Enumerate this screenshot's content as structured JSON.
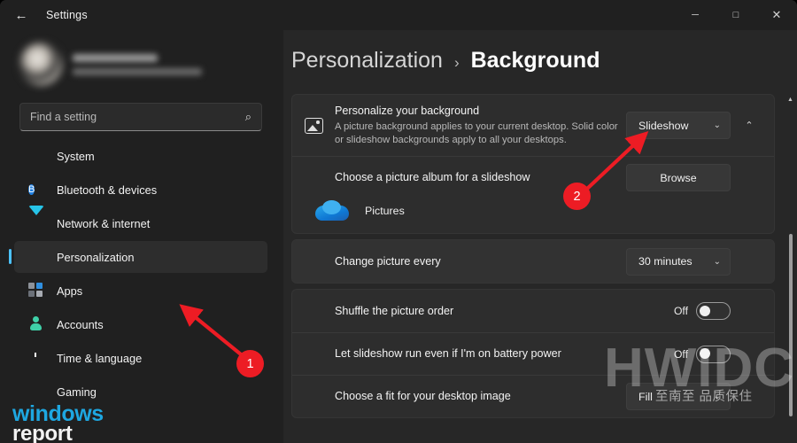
{
  "window": {
    "title": "Settings",
    "back_icon": "←",
    "minimize": "─",
    "maximize": "□",
    "close": "✕"
  },
  "sidebar": {
    "account": {
      "name_redacted": "",
      "email_redacted": ""
    },
    "search": {
      "placeholder": "Find a setting",
      "value": "",
      "icon": "⌕"
    },
    "items": [
      {
        "label": "System",
        "icon": "monitor-icon",
        "active": false
      },
      {
        "label": "Bluetooth & devices",
        "icon": "bluetooth-icon",
        "active": false
      },
      {
        "label": "Network & internet",
        "icon": "wifi-icon",
        "active": false
      },
      {
        "label": "Personalization",
        "icon": "brush-icon",
        "active": true
      },
      {
        "label": "Apps",
        "icon": "apps-icon",
        "active": false
      },
      {
        "label": "Accounts",
        "icon": "person-icon",
        "active": false
      },
      {
        "label": "Time & language",
        "icon": "clock-icon",
        "active": false
      },
      {
        "label": "Gaming",
        "icon": "gamepad-icon",
        "active": false
      }
    ]
  },
  "breadcrumb": {
    "parent": "Personalization",
    "separator": "›",
    "current": "Background"
  },
  "main": {
    "personalize": {
      "title": "Personalize your background",
      "description": "A picture background applies to your current desktop. Solid color or slideshow backgrounds apply to all your desktops.",
      "dropdown_value": "Slideshow",
      "dropdown_chevron": "⌄",
      "expander_chevron": "⌃"
    },
    "album": {
      "label": "Choose a picture album for a slideshow",
      "button": "Browse",
      "folder_name": "Pictures"
    },
    "change_every": {
      "label": "Change picture every",
      "value": "30 minutes",
      "chevron": "⌄"
    },
    "shuffle": {
      "label": "Shuffle the picture order",
      "state": "Off"
    },
    "battery": {
      "label": "Let slideshow run even if I'm on battery power",
      "state": "Off"
    },
    "fit": {
      "label": "Choose a fit for your desktop image",
      "value": "Fill",
      "chevron": "⌄"
    }
  },
  "scrollbar": {
    "up_arrow": "▲"
  },
  "annotations": [
    {
      "number": "1",
      "target": "sidebar-item-personalization"
    },
    {
      "number": "2",
      "target": "background-type-dropdown"
    }
  ],
  "watermarks": {
    "hwidc": "HWIDC",
    "chinese": "至南至  品质保住",
    "windows_report_line1": "windows",
    "windows_report_line2": "report"
  },
  "colors": {
    "accent": "#4cc2ff",
    "annotation": "#ed1c24",
    "window_bg": "#202020",
    "content_bg": "#272727",
    "card_bg": "#2d2d2d"
  }
}
